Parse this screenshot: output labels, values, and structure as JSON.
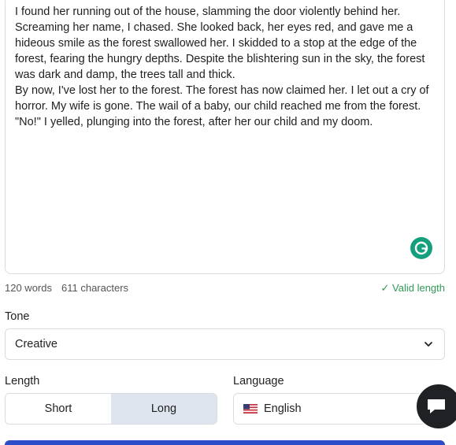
{
  "editor": {
    "text": "I found her running out of the house, slamming the door violently behind her.\nScreaming her name, I chased. She looked back, her eyes red, and gave me a\nhideous smile as the forest swallowed her. I skidded to a stop at the edge of the\nforest, fearing the hungry depths. Despite the blishtering sun in the sky, the forest\nwas dark and damp, the trees tall and thick.\nBy now, I've lost her to the forest. The forest has now claimed her. I let out a cry of\nhorror. My wife is gone. The wail of a baby, our child reached me from the forest.\n\"No!\" I yelled, plunging into the forest, after her our child and my doom."
  },
  "stats": {
    "words": "120 words",
    "characters": "611 characters",
    "valid": "✓ Valid length"
  },
  "tone": {
    "label": "Tone",
    "value": "Creative"
  },
  "length": {
    "label": "Length",
    "options": [
      "Short",
      "Long"
    ],
    "selected": "Long"
  },
  "language": {
    "label": "Language",
    "value": "English"
  },
  "colors": {
    "accent": "#2b4dc7",
    "valid": "#2f9a57",
    "grammarly": "#15a07d",
    "segment_active": "#dfe5ee"
  }
}
